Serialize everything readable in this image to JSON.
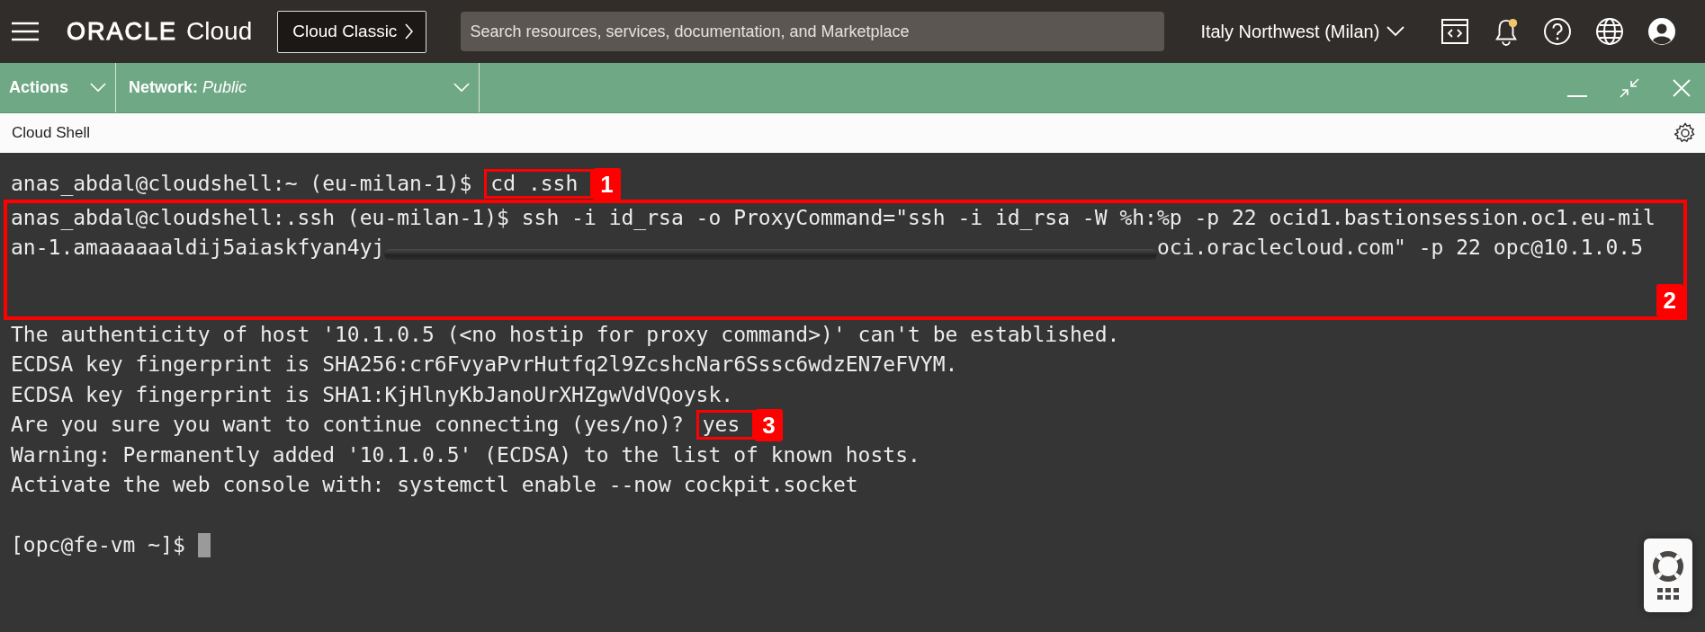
{
  "header": {
    "logo": {
      "brand": "ORACLE",
      "product": "Cloud"
    },
    "console_button": "Cloud Classic",
    "search": {
      "placeholder": "Search resources, services, documentation, and Marketplace"
    },
    "region": "Italy Northwest (Milan)",
    "notification_dot": true
  },
  "shell_toolbar": {
    "actions": "Actions",
    "network": {
      "label": "Network:",
      "value": "Public"
    }
  },
  "panel_title": "Cloud Shell",
  "terminal": {
    "blocks": [
      {
        "kind": "prompt",
        "prompt": "anas_abdal@cloudshell:~ (eu-milan-1)$",
        "input": "cd .ssh",
        "callout": "1"
      },
      {
        "kind": "group",
        "callout": "2",
        "lines": [
          {
            "segments": [
              {
                "kind": "text",
                "text": "anas_abdal@cloudshell:.ssh (eu-milan-1)$ ssh -i id_rsa -o ProxyCommand=\"ssh -i id_rsa -W %h:%p -p 22 ocid1.bastionsession.oc1.eu-mil"
              }
            ]
          },
          {
            "segments": [
              {
                "kind": "text",
                "text": "an-1.amaaaaaaldij5aiaskfyan4yj"
              },
              {
                "kind": "redaction"
              },
              {
                "kind": "text",
                "text": "oci.oraclecloud.com\" -p 22 opc@10.1.0.5"
              }
            ]
          }
        ]
      },
      {
        "kind": "output",
        "text": "The authenticity of host '10.1.0.5 (<no hostip for proxy command>)' can't be established."
      },
      {
        "kind": "output",
        "text": "ECDSA key fingerprint is SHA256:cr6FvyaPvrHutfq2l9ZcshcNar6Sssc6wdzEN7eFVYM."
      },
      {
        "kind": "output",
        "text": "ECDSA key fingerprint is SHA1:KjHlnyKbJanoUrXHZgwVdVQoysk."
      },
      {
        "kind": "prompt",
        "prompt": "Are you sure you want to continue connecting (yes/no)?",
        "input": "yes",
        "callout": "3"
      },
      {
        "kind": "output",
        "text": "Warning: Permanently added '10.1.0.5' (ECDSA) to the list of known hosts."
      },
      {
        "kind": "output",
        "text": "Activate the web console with: systemctl enable --now cockpit.socket"
      },
      {
        "kind": "blank"
      },
      {
        "kind": "cursor",
        "prompt": "[opc@fe-vm ~]$"
      }
    ]
  }
}
